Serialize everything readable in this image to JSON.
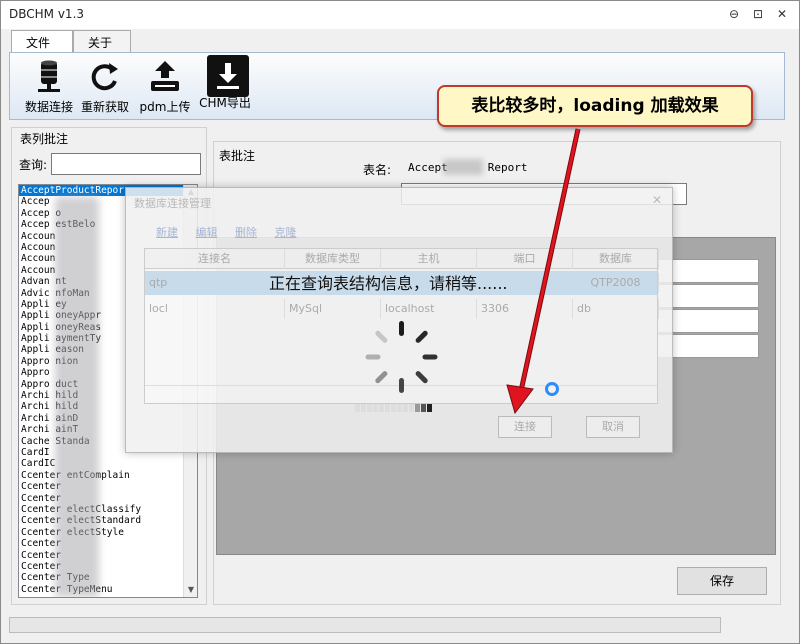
{
  "window": {
    "title": "DBCHM v1.3",
    "minimize": "⊖",
    "restore": "⊡",
    "close": "✕"
  },
  "menu_tabs": [
    "文件",
    "关于"
  ],
  "toolbar": {
    "connect_label": "数据连接",
    "refresh_label": "重新获取",
    "pdm_label": "pdm上传",
    "chm_label": "CHM导出"
  },
  "left": {
    "group_label": "表列批注",
    "query_label": "查询:",
    "query_value": "",
    "tables": [
      "AcceptProductRepor",
      "Accep",
      "Accep    o",
      "Accep     estBelo",
      "Accoun",
      "Accoun",
      "Accoun",
      "Accoun",
      "Advan      nt",
      "Advic      nfoMan",
      "Appli      ey",
      "Appli      oneyAppr",
      "Appli      oneyReas",
      "Appli      aymentTy",
      "Appli      eason",
      "Appro      nion",
      "Appro",
      "Appro       duct",
      "Archi       hild",
      "Archi       hild",
      "Archi       ainD",
      "Archi       ainT",
      "Cache       Standa",
      "CardI",
      "CardIC",
      "Ccenter     entComplain",
      "Ccenter",
      "Ccenter",
      "Ccenter      electClassify",
      "Ccenter      electStandard",
      "Ccenter      electStyle",
      "Ccenter",
      "Ccenter",
      "Ccenter",
      "Ccenter      Type",
      "Ccenter     TypeMenu"
    ]
  },
  "right": {
    "group_label": "表批注",
    "table_name_label": "表名:",
    "table_name_value": "Accept",
    "table_name_suffix": "Report",
    "comment_value": "",
    "save_label": "保存"
  },
  "dialog": {
    "title": "数据库连接管理",
    "close": "✕",
    "links": [
      "新建",
      "编辑",
      "删除",
      "克隆"
    ],
    "columns": [
      "连接名",
      "数据库类型",
      "主机",
      "端口",
      "数据库"
    ],
    "rows": [
      [
        "qtp",
        "",
        "",
        "",
        "QTP2008"
      ],
      [
        "locl",
        "MySql",
        "localhost",
        "3306",
        "db"
      ]
    ],
    "connect_label": "连接",
    "cancel_label": "取消"
  },
  "loading": {
    "message": "正在查询表结构信息，请稍等......"
  },
  "callout": {
    "text": "表比较多时，loading 加载效果"
  },
  "colors": {
    "accent": "#0078d7",
    "callout_border": "#c0392b",
    "callout_bg": "#fff7c6",
    "arrow": "#e0141e"
  }
}
